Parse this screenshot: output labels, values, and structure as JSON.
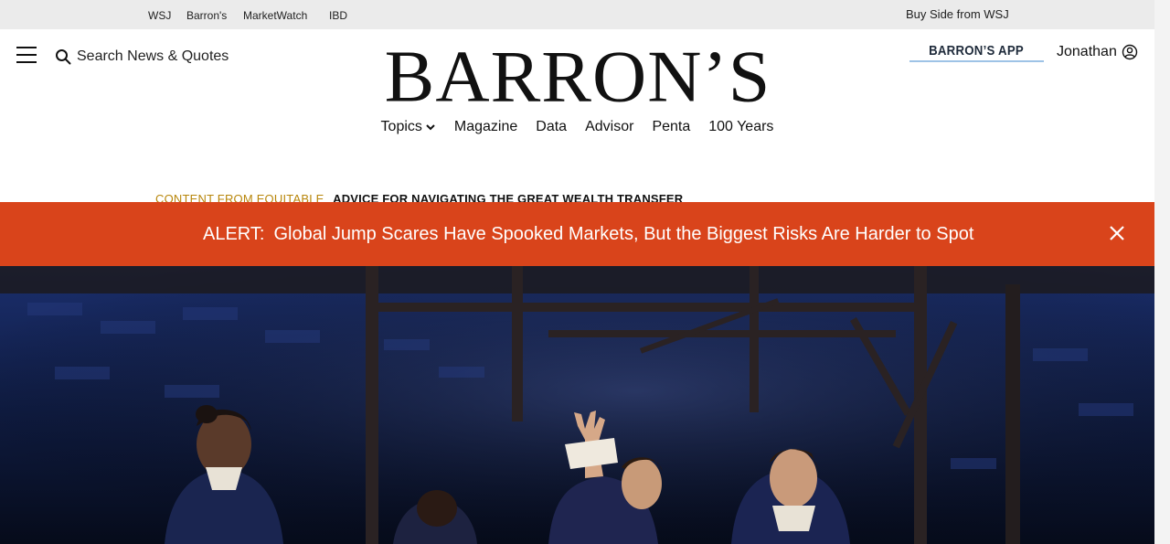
{
  "top_links": {
    "wsj": "WSJ",
    "barrons": "Barron's",
    "marketwatch": "MarketWatch",
    "ibd": "IBD",
    "buy_side": "Buy Side from WSJ"
  },
  "header": {
    "search_label": "Search News & Quotes",
    "logo_text": "BARRON’S",
    "app_button": "BARRON’S APP",
    "user_name": "Jonathan"
  },
  "nav": {
    "topics": "Topics",
    "magazine": "Magazine",
    "data": "Data",
    "advisor": "Advisor",
    "penta": "Penta",
    "years": "100 Years"
  },
  "sponsored": {
    "label": "CONTENT FROM EQUITABLE",
    "title": "ADVICE FOR NAVIGATING THE GREAT WEALTH TRANSFER"
  },
  "alert": {
    "prefix": "ALERT:",
    "headline": "Global Jump Scares Have Spooked Markets, But the Biggest Risks Are Harder to Spot"
  },
  "colors": {
    "alert_bg": "#d9441b",
    "topbar_bg": "#ebebeb",
    "sponsored_label": "#b8860b",
    "app_underline": "#9ec3e6"
  },
  "icons": {
    "menu": "hamburger-menu-icon",
    "search": "search-icon",
    "user": "user-circle-icon",
    "topics": "chevron-down-icon",
    "close": "close-icon"
  }
}
